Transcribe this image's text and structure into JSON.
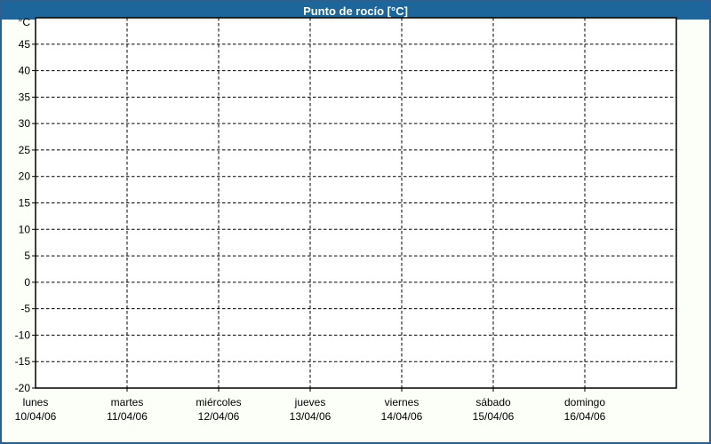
{
  "window": {
    "title": "Punto de rocío [°C]"
  },
  "colors": {
    "titlebar_bg": "#1c669b",
    "titlebar_text": "#ffffff",
    "outer_border": "#2b608f",
    "page_bg": "#fcfef8",
    "plot_bg": "#ffffff",
    "grid": "#000000",
    "axis": "#000000",
    "text": "#000000"
  },
  "chart_data": {
    "type": "line",
    "title": "Punto de rocío [°C]",
    "y_axis": {
      "unit_label": "°C",
      "min": -20,
      "max": 50,
      "tick_step": 5,
      "ticks": [
        45,
        40,
        35,
        30,
        25,
        20,
        15,
        10,
        5,
        0,
        -5,
        -10,
        -15,
        -20
      ],
      "gridlines": "dashed"
    },
    "x_axis": {
      "categories": [
        {
          "day": "lunes",
          "date": "10/04/06"
        },
        {
          "day": "martes",
          "date": "11/04/06"
        },
        {
          "day": "miércoles",
          "date": "12/04/06"
        },
        {
          "day": "jueves",
          "date": "13/04/06"
        },
        {
          "day": "viernes",
          "date": "14/04/06"
        },
        {
          "day": "sábado",
          "date": "15/04/06"
        },
        {
          "day": "domingo",
          "date": "16/04/06"
        }
      ],
      "gridlines": "dashed"
    },
    "series": [],
    "legend": "none",
    "grid": true
  }
}
